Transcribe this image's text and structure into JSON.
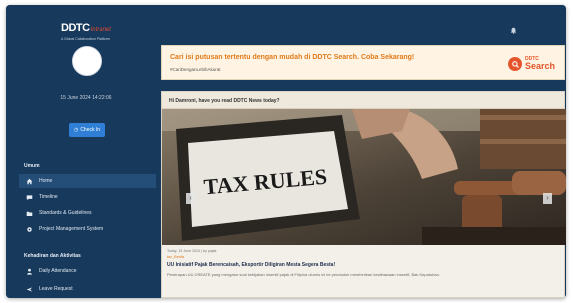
{
  "brand": {
    "logo_main": "DDTC",
    "logo_sub": "Intranet",
    "tagline": "A Global Collaboration Platform"
  },
  "sidebar": {
    "datetime": "15 June 2024 14:22:06",
    "checkin_label": "Check In",
    "section_general": "Umum",
    "items": [
      {
        "label": "Home",
        "icon": "home-icon"
      },
      {
        "label": "Timeline",
        "icon": "chat-icon"
      },
      {
        "label": "Standards & Guidelines",
        "icon": "folder-icon"
      },
      {
        "label": "Project Management System",
        "icon": "gear-icon"
      }
    ],
    "section_attendance": "Kehadiran dan Aktivitas",
    "attendance_items": [
      {
        "label": "Daily Attendance",
        "icon": "person-icon"
      },
      {
        "label": "Leave Request",
        "icon": "plane-icon"
      }
    ]
  },
  "banner": {
    "title": "Cari isi putusan tertentu dengan mudah di DDTC Search. Coba Sekarang!",
    "tag": "#CariDenganLebihAkurat",
    "logo_top": "DDTC",
    "logo_bottom": "Search"
  },
  "news": {
    "greeting": "Hi Damroni, have you read DDTC News today?",
    "image_text": "TAX RULES",
    "meta": "Today, 15 June 2024 | by pajak",
    "category": "tax_Berita",
    "title": "UU Inisiatif Pajak Berencaisah, Eksportir Diligiran Mesta Segera Besta!",
    "excerpt": "Penerapan UU CREATE yang mengatur soal kebijakan insentif pajak di Filipina ulurnis ini ke penduduk memberikan kewibawaan insentif, Bak Kepatuhan."
  },
  "colors": {
    "sidebar_bg": "#17395c",
    "accent": "#2f7fd6",
    "brand_orange": "#e07a1a",
    "search_red": "#e4552b"
  }
}
